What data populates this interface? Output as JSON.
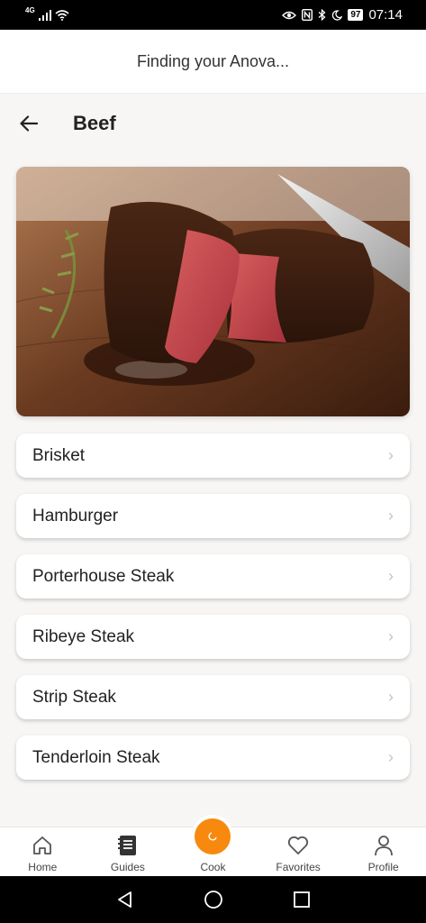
{
  "status_bar": {
    "network_label": "4G",
    "battery_level": "97",
    "time": "07:14"
  },
  "banner": {
    "text": "Finding your Anova..."
  },
  "header": {
    "title": "Beef"
  },
  "list": {
    "items": [
      {
        "label": "Brisket"
      },
      {
        "label": "Hamburger"
      },
      {
        "label": "Porterhouse Steak"
      },
      {
        "label": "Ribeye Steak"
      },
      {
        "label": "Strip Steak"
      },
      {
        "label": "Tenderloin Steak"
      }
    ]
  },
  "tabbar": {
    "tabs": [
      {
        "label": "Home",
        "icon": "home-icon"
      },
      {
        "label": "Guides",
        "icon": "guides-icon"
      },
      {
        "label": "Cook",
        "icon": "cook-icon"
      },
      {
        "label": "Favorites",
        "icon": "heart-icon"
      },
      {
        "label": "Profile",
        "icon": "profile-icon"
      }
    ],
    "accent_color": "#f7890f"
  }
}
